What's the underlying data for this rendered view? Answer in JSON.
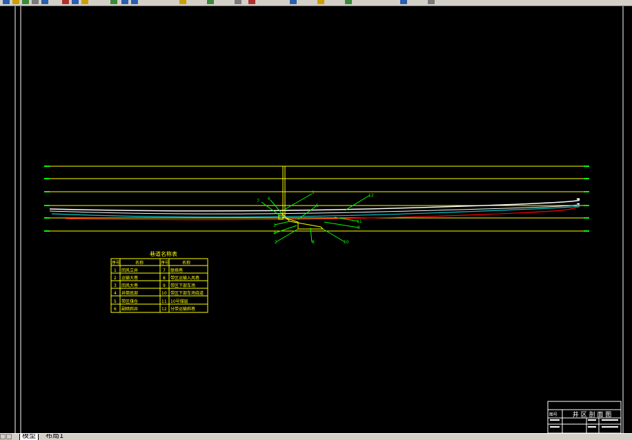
{
  "toolbar": {
    "icons": [
      "new-icon",
      "open-icon",
      "save-icon",
      "print-icon",
      "preview-icon",
      "cut-icon",
      "copy-icon",
      "paste-icon",
      "match-icon",
      "undo-icon",
      "redo-icon",
      "pan-icon",
      "zoom-realtime-icon",
      "zoom-window-icon",
      "zoom-previous-icon",
      "properties-icon",
      "design-center-icon",
      "tool-palette-icon",
      "layer-icon",
      "help-icon"
    ]
  },
  "colors": {
    "background": "#000000",
    "yellow": "#ffff00",
    "green": "#00ff00",
    "white": "#ffffff",
    "cyan": "#00c8c8",
    "red": "#ff0000",
    "border": "#ffffff"
  },
  "drawing": {
    "table": {
      "title": "巷道名称表",
      "headers": [
        "序号",
        "名称",
        "序号",
        "名称"
      ],
      "rows": [
        [
          "1",
          "回风立井",
          "7",
          "联络巷"
        ],
        [
          "2",
          "运输大巷",
          "8",
          "带区运输入风巷"
        ],
        [
          "3",
          "回风大巷",
          "9",
          "带区下部车场"
        ],
        [
          "4",
          "井筒底部",
          "10",
          "带区下部车场绕道"
        ],
        [
          "5",
          "带区煤仓",
          "11",
          "10号煤层"
        ],
        [
          "6",
          "副暗斜井",
          "12",
          "分带运输斜巷"
        ]
      ]
    },
    "callouts": [
      "1",
      "2",
      "3",
      "4",
      "5",
      "6",
      "7",
      "8",
      "9",
      "10",
      "11",
      "12"
    ],
    "title_block": {
      "label": "图号",
      "title": "井 区 剖 面 图"
    }
  },
  "tabs": {
    "model": "模型",
    "layout1": "布局1"
  }
}
